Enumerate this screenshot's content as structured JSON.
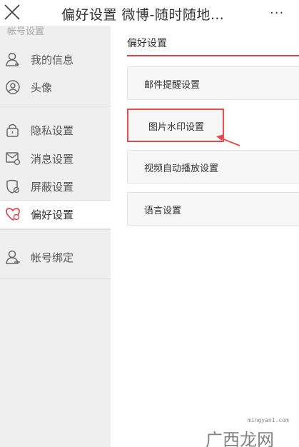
{
  "header": {
    "title": "偏好设置 微博-随时随地…",
    "more": "···"
  },
  "sidebar": {
    "section_label": "帐号设置",
    "items": [
      {
        "label": "我的信息",
        "icon": "person-icon"
      },
      {
        "label": "头像",
        "icon": "avatar-icon"
      },
      {
        "label": "隐私设置",
        "icon": "lock-icon"
      },
      {
        "label": "消息设置",
        "icon": "message-icon"
      },
      {
        "label": "屏蔽设置",
        "icon": "shield-icon"
      },
      {
        "label": "偏好设置",
        "icon": "heart-icon",
        "active": true
      },
      {
        "label": "帐号绑定",
        "icon": "account-bind-icon"
      }
    ]
  },
  "main": {
    "header": "偏好设置",
    "options": [
      {
        "label": "邮件提醒设置"
      },
      {
        "label": "图片水印设置",
        "highlighted": true
      },
      {
        "label": "视频自动播放设置"
      },
      {
        "label": "语言设置"
      }
    ]
  },
  "watermark": {
    "url": "mingyan1.com",
    "text": "广西龙网"
  },
  "colors": {
    "accent": "#e0454a",
    "sidebar_bg": "#efefef",
    "option_bg": "#f7f7f7"
  }
}
